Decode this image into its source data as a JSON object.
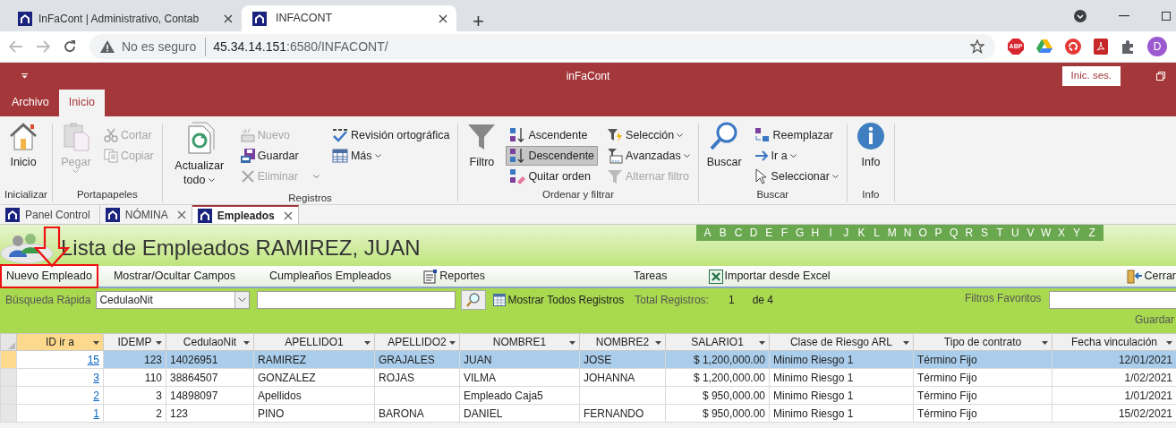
{
  "browser": {
    "tabs": [
      {
        "title": "InFaCont | Administrativo, Contab",
        "selected": false
      },
      {
        "title": "INFACONT",
        "selected": true
      }
    ],
    "new_tab": "+",
    "address": {
      "security": "No es seguro",
      "host": "45.34.14.151",
      "path": ":6580/INFACONT/"
    },
    "extension_label": "ABP",
    "avatar": "D"
  },
  "app": {
    "title": "inFaCont",
    "sign_in": "Inic. ses."
  },
  "ribbon_tabs": [
    {
      "label": "Archivo",
      "selected": false
    },
    {
      "label": "Inicio",
      "selected": true
    }
  ],
  "ribbon_groups": [
    {
      "label": "Inicializar",
      "columns": [
        [
          {
            "label": "Inicio",
            "kind": "large",
            "disabled": false,
            "dropdown": false,
            "pressed": false
          }
        ]
      ]
    },
    {
      "label": "Portapapeles",
      "columns": [
        [
          {
            "label": "Pegar",
            "kind": "large",
            "disabled": true,
            "dropdown": true,
            "pressed": false
          }
        ],
        [
          {
            "label": "Cortar",
            "kind": "small",
            "disabled": true,
            "dropdown": false,
            "pressed": false
          },
          {
            "label": "Copiar",
            "kind": "small",
            "disabled": true,
            "dropdown": false,
            "pressed": false
          }
        ]
      ]
    },
    {
      "label": "Registros",
      "columns": [
        [
          {
            "label": "Actualizar todo",
            "kind": "large",
            "disabled": false,
            "dropdown": true,
            "pressed": false
          }
        ],
        [
          {
            "label": "Nuevo",
            "kind": "small",
            "disabled": true,
            "dropdown": false,
            "pressed": false
          },
          {
            "label": "Guardar",
            "kind": "small",
            "disabled": false,
            "dropdown": false,
            "pressed": false
          },
          {
            "label": "Eliminar",
            "kind": "split",
            "disabled": true,
            "dropdown": true,
            "pressed": false
          }
        ],
        [
          {
            "label": "Revisión ortográfica",
            "kind": "small",
            "disabled": false,
            "dropdown": false,
            "pressed": false
          },
          {
            "label": "Más",
            "kind": "small",
            "disabled": false,
            "dropdown": true,
            "pressed": false
          }
        ]
      ]
    },
    {
      "label": "Ordenar y filtrar",
      "columns": [
        [
          {
            "label": "Filtro",
            "kind": "large",
            "disabled": false,
            "dropdown": false,
            "pressed": false
          }
        ],
        [
          {
            "label": "Ascendente",
            "kind": "small",
            "disabled": false,
            "dropdown": false,
            "pressed": false
          },
          {
            "label": "Descendente",
            "kind": "small",
            "disabled": false,
            "dropdown": false,
            "pressed": true
          },
          {
            "label": "Quitar orden",
            "kind": "small",
            "disabled": false,
            "dropdown": false,
            "pressed": false
          }
        ],
        [
          {
            "label": "Selección",
            "kind": "small",
            "disabled": false,
            "dropdown": true,
            "pressed": false
          },
          {
            "label": "Avanzadas",
            "kind": "small",
            "disabled": false,
            "dropdown": true,
            "pressed": false
          },
          {
            "label": "Alternar filtro",
            "kind": "small",
            "disabled": true,
            "dropdown": false,
            "pressed": false
          }
        ]
      ]
    },
    {
      "label": "Buscar",
      "columns": [
        [
          {
            "label": "Buscar",
            "kind": "large",
            "disabled": false,
            "dropdown": false,
            "pressed": false
          }
        ],
        [
          {
            "label": "Reemplazar",
            "kind": "small",
            "disabled": false,
            "dropdown": false,
            "pressed": false
          },
          {
            "label": "Ir a",
            "kind": "small",
            "disabled": false,
            "dropdown": true,
            "pressed": false
          },
          {
            "label": "Seleccionar",
            "kind": "small",
            "disabled": false,
            "dropdown": true,
            "pressed": false
          }
        ]
      ]
    },
    {
      "label": "Info",
      "columns": [
        [
          {
            "label": "Info",
            "kind": "large",
            "disabled": false,
            "dropdown": false,
            "pressed": false
          }
        ]
      ]
    }
  ],
  "document_tabs": [
    {
      "label": "Panel Control",
      "selected": false,
      "closable": false
    },
    {
      "label": "NÓMINA",
      "selected": false,
      "closable": true
    },
    {
      "label": "Empleados",
      "selected": true,
      "closable": true
    }
  ],
  "form": {
    "title": "Lista de Empleados RAMIREZ, JUAN",
    "letters": [
      "A",
      "B",
      "C",
      "D",
      "E",
      "F",
      "G",
      "H",
      "I",
      "J",
      "K",
      "L",
      "M",
      "N",
      "O",
      "P",
      "Q",
      "R",
      "S",
      "T",
      "U",
      "V",
      "W",
      "X",
      "Y",
      "Z"
    ],
    "toolbar": [
      {
        "label": "Nuevo Empleado",
        "annotated": true,
        "kind": "plain"
      },
      {
        "label": "Mostrar/Ocultar Campos",
        "annotated": false,
        "kind": "plain"
      },
      {
        "label": "Cumpleaños Empleados",
        "annotated": false,
        "kind": "plain"
      },
      {
        "label": "Reportes",
        "annotated": false,
        "kind": "report"
      },
      {
        "label": "Tareas",
        "annotated": false,
        "kind": "plain"
      },
      {
        "label": "Importar desde Excel",
        "annotated": false,
        "kind": "excel"
      }
    ],
    "close_button": "Cerrar",
    "search": {
      "label": "Búsqueda Rápida",
      "field": "CedulaoNit",
      "show_all": "Mostrar Todos Registros",
      "total_label": "Total Registros:",
      "current": "1",
      "of_total": "de 4",
      "favorites_label": "Filtros Favoritos",
      "save": "Guardar"
    }
  },
  "table": {
    "columns": [
      {
        "label": "ID ir a",
        "kind": "link",
        "selected": true
      },
      {
        "label": "IDEMP",
        "kind": "number",
        "selected": false
      },
      {
        "label": "CedulaoNit",
        "kind": "text",
        "selected": false
      },
      {
        "label": "APELLIDO1",
        "kind": "text",
        "selected": false
      },
      {
        "label": "APELLIDO2",
        "kind": "text",
        "selected": false
      },
      {
        "label": "NOMBRE1",
        "kind": "text",
        "selected": false
      },
      {
        "label": "NOMBRE2",
        "kind": "text",
        "selected": false
      },
      {
        "label": "SALARIO1",
        "kind": "number",
        "selected": false
      },
      {
        "label": "Clase de Riesgo ARL",
        "kind": "text",
        "selected": false
      },
      {
        "label": "Tipo de contrato",
        "kind": "text",
        "selected": false
      },
      {
        "label": "Fecha vinculación",
        "kind": "number",
        "selected": false
      }
    ],
    "rows": [
      {
        "selected": true,
        "cells": [
          "15",
          "123",
          "14026951",
          "RAMIREZ",
          "GRAJALES",
          "JUAN",
          "JOSE",
          "$ 1,200,000.00",
          "Minimo Riesgo 1",
          "Término Fijo",
          "12/01/2021"
        ]
      },
      {
        "selected": false,
        "cells": [
          "3",
          "110",
          "38864507",
          "GONZALEZ",
          "ROJAS",
          "VILMA",
          "JOHANNA",
          "$ 1,200,000.00",
          "Minimo Riesgo 1",
          "Término Fijo",
          "1/02/2021"
        ]
      },
      {
        "selected": false,
        "cells": [
          "2",
          "3",
          "14898097",
          "Apellidos",
          "",
          "Empleado Caja5",
          "",
          "$ 950,000.00",
          "Minimo Riesgo 1",
          "Término Fijo",
          "1/01/2021"
        ]
      },
      {
        "selected": false,
        "cells": [
          "1",
          "2",
          "123",
          "PINO",
          "BARONA",
          "DANIEL",
          "FERNANDO",
          "$ 950,000.00",
          "Minimo Riesgo 1",
          "Término Fijo",
          "15/02/2021"
        ]
      }
    ]
  }
}
